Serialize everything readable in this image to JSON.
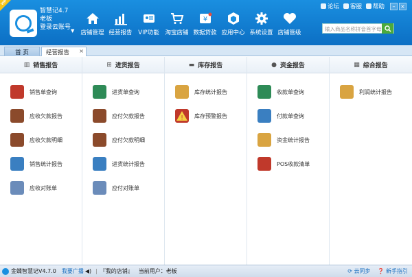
{
  "header": {
    "vip_badge": "VIP",
    "app_title": "智慧记4.7",
    "user_role": "老板",
    "switch_account": "登录云账号",
    "topbar": {
      "forum": "论坛",
      "support": "客服",
      "help": "帮助"
    },
    "search_placeholder": "输入商品名称拼音首字母",
    "nav": [
      {
        "label": "店铺管理",
        "icon": "home-icon"
      },
      {
        "label": "经营报告",
        "icon": "bar-chart-icon"
      },
      {
        "label": "VIP功能",
        "icon": "vip-card-icon"
      },
      {
        "label": "淘宝店铺",
        "icon": "cart-icon"
      },
      {
        "label": "数据贷款",
        "icon": "money-icon"
      },
      {
        "label": "应用中心",
        "icon": "hexagon-icon"
      },
      {
        "label": "系统设置",
        "icon": "gear-icon"
      },
      {
        "label": "店铺管级",
        "icon": "heart-icon"
      }
    ]
  },
  "tabs": {
    "home": "首 页",
    "report": "经营报告"
  },
  "columns": [
    {
      "title": "销售报告",
      "icon": "bar-chart-icon",
      "items": [
        {
          "label": "销售单查询",
          "color": "#c0392b"
        },
        {
          "label": "应收欠款报告",
          "color": "#8b4a2b"
        },
        {
          "label": "应收欠款明细",
          "color": "#8b4a2b"
        },
        {
          "label": "销售统计报告",
          "color": "#3a7fc1"
        },
        {
          "label": "应收对账单",
          "color": "#6b8cba"
        }
      ]
    },
    {
      "title": "进货报告",
      "icon": "cart-icon",
      "items": [
        {
          "label": "进货单查询",
          "color": "#2e8b57"
        },
        {
          "label": "应付欠款报告",
          "color": "#8b4a2b"
        },
        {
          "label": "应付欠款明细",
          "color": "#8b4a2b"
        },
        {
          "label": "进货统计报告",
          "color": "#3a7fc1"
        },
        {
          "label": "应付对账单",
          "color": "#6b8cba"
        }
      ]
    },
    {
      "title": "库存报告",
      "icon": "box-icon",
      "items": [
        {
          "label": "库存统计报告",
          "color": "#d9a441"
        },
        {
          "label": "库存预警报告",
          "color": "#c0392b"
        }
      ]
    },
    {
      "title": "资金报告",
      "icon": "coin-icon",
      "items": [
        {
          "label": "收款单查询",
          "color": "#2e8b57"
        },
        {
          "label": "付款单查询",
          "color": "#3a7fc1"
        },
        {
          "label": "资金统计报告",
          "color": "#d9a441"
        },
        {
          "label": "POS收款清单",
          "color": "#c0392b"
        }
      ]
    },
    {
      "title": "综合报告",
      "icon": "grid-icon",
      "items": [
        {
          "label": "利润统计报告",
          "color": "#d9a441"
        }
      ]
    }
  ],
  "status": {
    "app": "金蝶智慧记V4.7.0",
    "broadcast": "我要广播",
    "my_shop": "『我的店铺』",
    "current_user_label": "当前用户：",
    "current_user": "老板",
    "cloud_sync": "云同步",
    "guide": "新手指引"
  }
}
